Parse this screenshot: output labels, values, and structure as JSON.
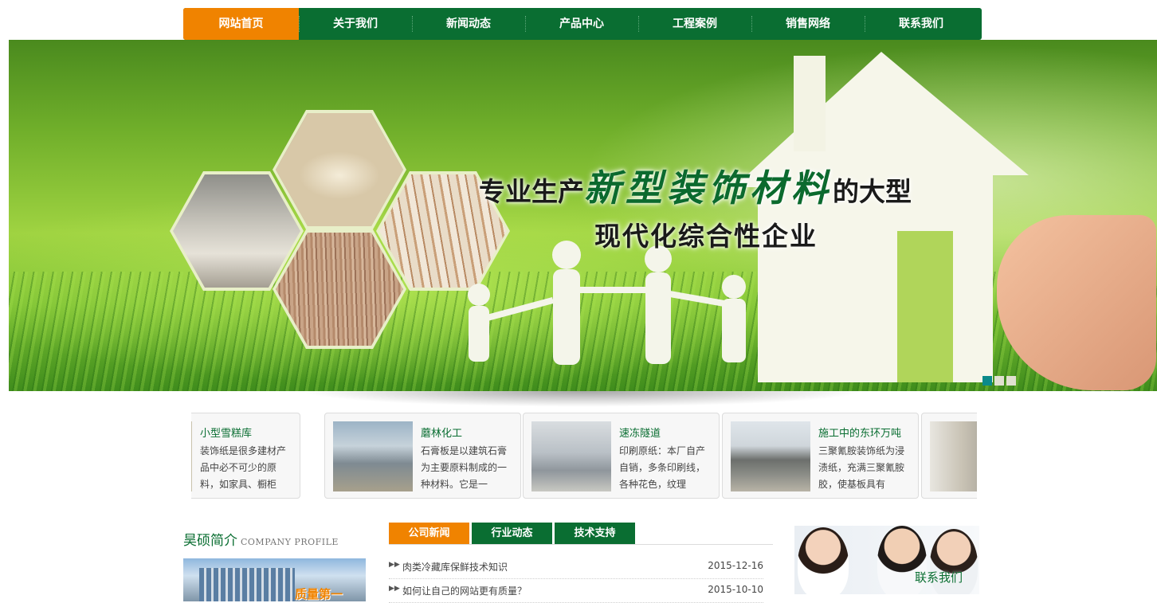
{
  "nav": {
    "items": [
      {
        "label": "网站首页",
        "active": true
      },
      {
        "label": "关于我们",
        "active": false
      },
      {
        "label": "新闻动态",
        "active": false
      },
      {
        "label": "产品中心",
        "active": false
      },
      {
        "label": "工程案例",
        "active": false
      },
      {
        "label": "销售网络",
        "active": false
      },
      {
        "label": "联系我们",
        "active": false
      }
    ]
  },
  "banner": {
    "slogan_prefix": "专业生产",
    "slogan_highlight": "新型装饰材料",
    "slogan_suffix": "的大型",
    "slogan_line2": "现代化综合性企业",
    "slides": 3,
    "active_slide": 1
  },
  "colors": {
    "brand_green": "#0a6e32",
    "accent_orange": "#f08300"
  },
  "products": [
    {
      "title": "小型雪糕库",
      "desc": "装饰纸是很多建材产品中必不可少的原料，如家具、橱柜"
    },
    {
      "title": "蘑林化工",
      "desc": "石膏板是以建筑石膏为主要原料制成的一种材料。它是一"
    },
    {
      "title": "速冻隧道",
      "desc": "印刷原纸：本厂自产自销，多条印刷线，各种花色，纹理"
    },
    {
      "title": "施工中的东环万吨",
      "desc": "三聚氰胺装饰纸为浸渍纸，充满三聚氰胺胶，使基板具有"
    },
    {
      "title": "",
      "desc": ""
    }
  ],
  "about": {
    "title": "昊硕简介",
    "title_en": "COMPANY PROFILE",
    "image_text": "质量第一"
  },
  "news": {
    "tabs": [
      {
        "label": "公司新闻",
        "active": true
      },
      {
        "label": "行业动态",
        "active": false
      },
      {
        "label": "技术支持",
        "active": false
      }
    ],
    "items": [
      {
        "title": "肉类冷藏库保鲜技术知识",
        "date": "2015-12-16"
      },
      {
        "title": "如何让自己的网站更有质量？",
        "date": "2015-10-10"
      }
    ]
  },
  "contact": {
    "label": "联系我们"
  }
}
